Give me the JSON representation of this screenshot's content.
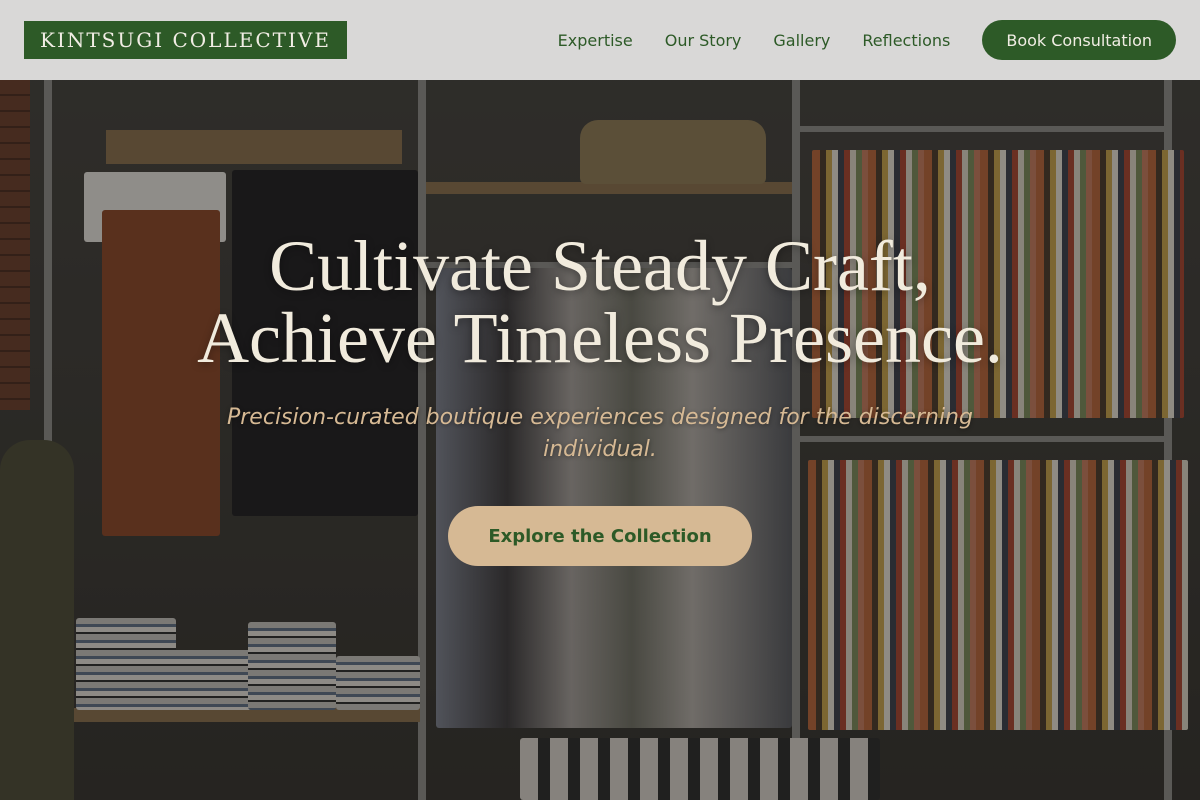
{
  "brand": {
    "name": "KINTSUGI COLLECTIVE"
  },
  "nav": {
    "links": [
      "Expertise",
      "Our Story",
      "Gallery",
      "Reflections"
    ],
    "cta_label": "Book Consultation"
  },
  "hero": {
    "title_line1": "Cultivate Steady Craft,",
    "title_line2": "Achieve Timeless Presence.",
    "subtitle": "Precision-curated boutique experiences designed for the discerning individual.",
    "cta_label": "Explore the Collection",
    "background_description_icon": "boutique-photo"
  },
  "colors": {
    "brand_green": "#2d5a27",
    "accent_tan": "#d6b994",
    "cream": "#f1ebdd",
    "nav_bg": "#e6e5e4"
  }
}
